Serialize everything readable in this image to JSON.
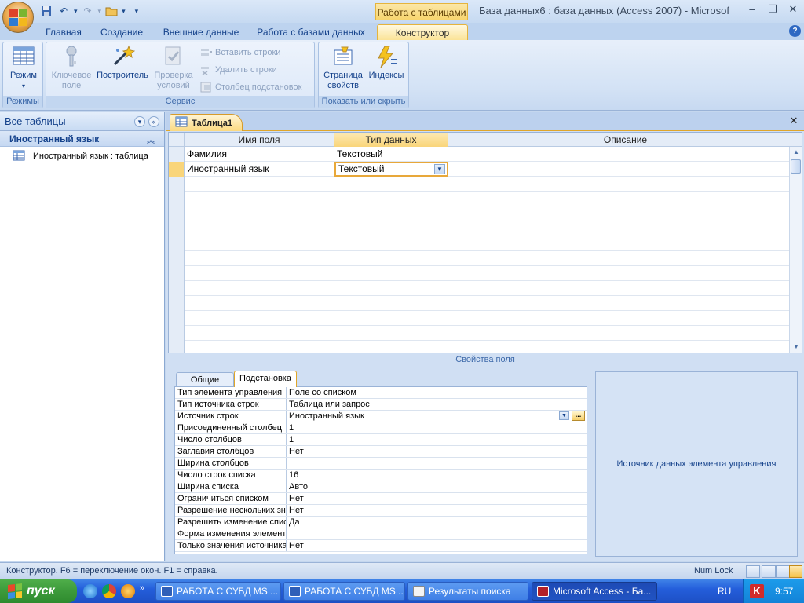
{
  "window": {
    "title": "База данных6 : база данных (Access 2007) - Microsof",
    "context_tab": "Работа с таблицами"
  },
  "ribbon_tabs": [
    "Главная",
    "Создание",
    "Внешние данные",
    "Работа с базами данных",
    "Конструктор"
  ],
  "ribbon": {
    "groups": {
      "modes": "Режимы",
      "service": "Сервис",
      "show_hide": "Показать или скрыть"
    },
    "buttons": {
      "view": "Режим",
      "primary_key": "Ключевое\nполе",
      "builder": "Построитель",
      "test_rules": "Проверка\nусловий",
      "insert_rows": "Вставить строки",
      "delete_rows": "Удалить строки",
      "lookup_column": "Столбец подстановок",
      "property_sheet": "Страница\nсвойств",
      "indexes": "Индексы"
    }
  },
  "nav_pane": {
    "header": "Все таблицы",
    "group": "Иностранный язык",
    "items": [
      "Иностранный язык : таблица"
    ]
  },
  "document": {
    "tab": "Таблица1",
    "columns": [
      "Имя поля",
      "Тип данных",
      "Описание"
    ],
    "rows": [
      {
        "name": "Фамилия",
        "type": "Текстовый",
        "desc": ""
      },
      {
        "name": "Иностранный язык",
        "type": "Текстовый",
        "desc": ""
      }
    ]
  },
  "field_props": {
    "title": "Свойства поля",
    "tabs": [
      "Общие",
      "Подстановка"
    ],
    "rows": [
      {
        "name": "Тип элемента управления",
        "value": "Поле со списком"
      },
      {
        "name": "Тип источника строк",
        "value": "Таблица или запрос"
      },
      {
        "name": "Источник строк",
        "value": "Иностранный язык"
      },
      {
        "name": "Присоединенный столбец",
        "value": "1"
      },
      {
        "name": "Число столбцов",
        "value": "1"
      },
      {
        "name": "Заглавия столбцов",
        "value": "Нет"
      },
      {
        "name": "Ширина столбцов",
        "value": ""
      },
      {
        "name": "Число строк списка",
        "value": "16"
      },
      {
        "name": "Ширина списка",
        "value": "Авто"
      },
      {
        "name": "Ограничиться списком",
        "value": "Нет"
      },
      {
        "name": "Разрешение нескольких значений",
        "value": "Нет"
      },
      {
        "name": "Разрешить изменение списка значений",
        "value": "Да"
      },
      {
        "name": "Форма изменения элементов списка",
        "value": ""
      },
      {
        "name": "Только значения источника строк",
        "value": "Нет"
      }
    ],
    "help_text": "Источник данных элемента управления"
  },
  "status": {
    "text": "Конструктор.  F6 = переключение окон.  F1 = справка.",
    "numlock": "Num Lock"
  },
  "taskbar": {
    "start": "пуск",
    "tasks": [
      "РАБОТА С СУБД MS ...",
      "РАБОТА С СУБД MS ...",
      "Результаты поиска",
      "Microsoft Access - Ба..."
    ],
    "lang": "RU",
    "clock": "9:57"
  }
}
